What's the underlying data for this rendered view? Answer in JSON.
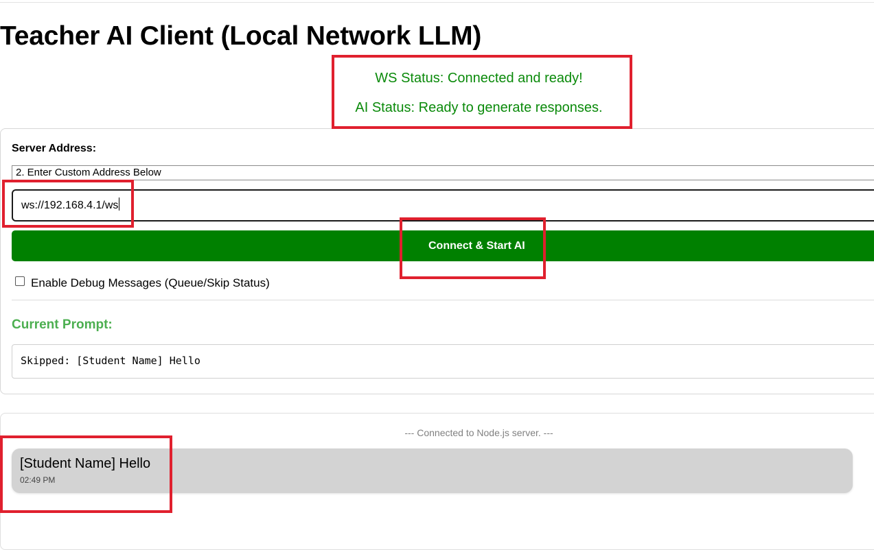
{
  "page": {
    "title": "Teacher AI Client (Local Network LLM)"
  },
  "status": {
    "ws": "WS Status: Connected and ready!",
    "ai": "AI Status: Ready to generate responses.",
    "color": "#0a8a0a"
  },
  "settings": {
    "server_label": "Server Address:",
    "server_select_value": "2. Enter Custom Address Below",
    "address_value": "ws://192.168.4.1/ws",
    "connect_label": "Connect & Start AI",
    "connect_color": "#008000",
    "debug_label": "Enable Debug Messages (Queue/Skip Status)",
    "debug_checked": false
  },
  "prompt": {
    "heading": "Current Prompt:",
    "heading_color": "#4caf50",
    "text": "Skipped: [Student Name] Hello"
  },
  "chat": {
    "system_message": "--- Connected to Node.js server. ---",
    "messages": [
      {
        "text": "[Student Name] Hello",
        "time": "02:49 PM"
      }
    ]
  },
  "annotations": {
    "highlight_color": "#e0202e"
  }
}
